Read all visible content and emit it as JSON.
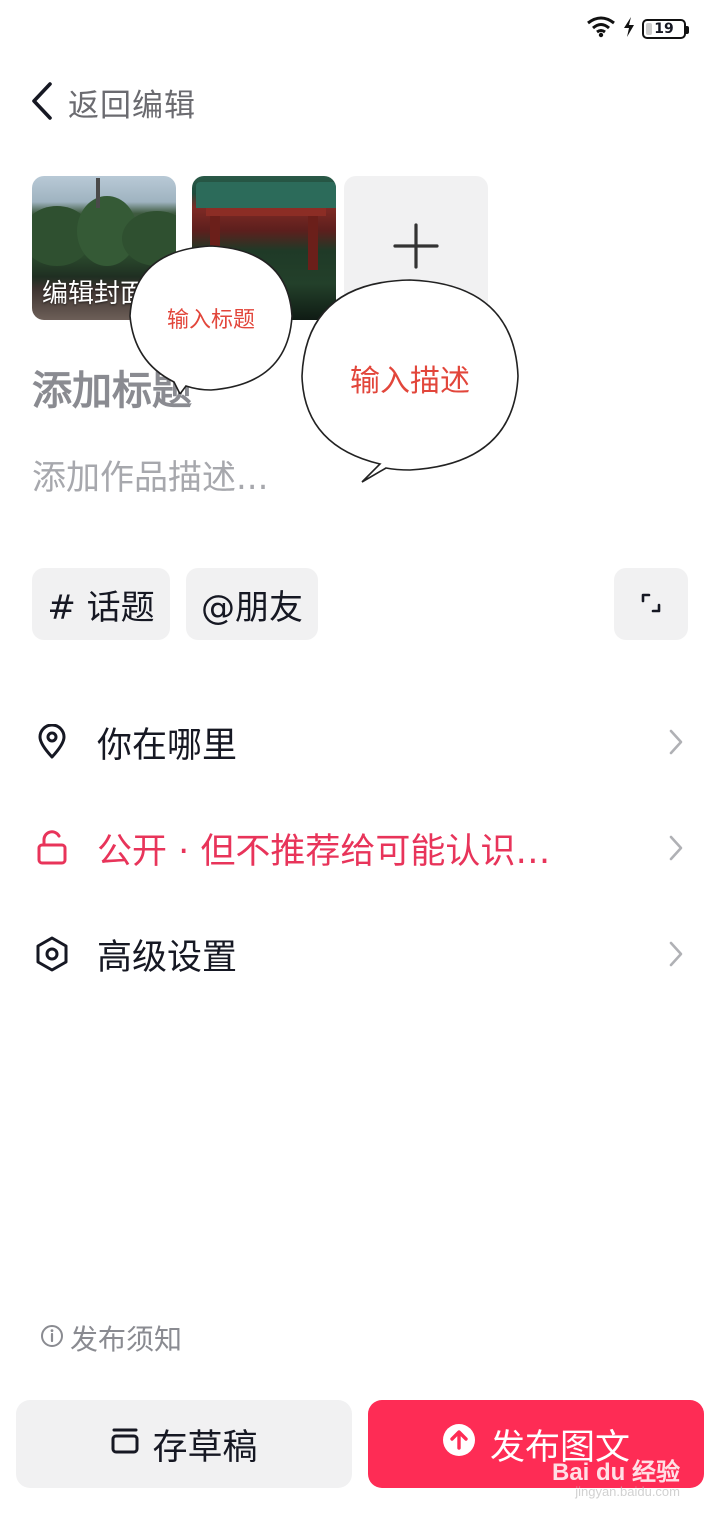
{
  "status_bar": {
    "battery_level": "19"
  },
  "header": {
    "back_label": "返回编辑"
  },
  "media": {
    "cover_label": "编辑封面"
  },
  "fields": {
    "title_placeholder": "添加标题",
    "description_placeholder": "添加作品描述..."
  },
  "annotations": {
    "title_callout": "输入标题",
    "description_callout": "输入描述"
  },
  "chips": {
    "topic": "# 话题",
    "friend": "@朋友"
  },
  "rows": [
    {
      "label": "你在哪里",
      "icon": "location-pin-icon"
    },
    {
      "label": "公开 · 但不推荐给可能认识…",
      "icon": "unlock-icon",
      "color": "#e8345a"
    },
    {
      "label": "高级设置",
      "icon": "settings-hex-icon"
    }
  ],
  "footer": {
    "notice": "发布须知",
    "draft_button": "存草稿",
    "publish_button": "发布图文"
  },
  "watermark": {
    "brand": "Bai du 经验",
    "url": "jingyan.baidu.com"
  },
  "colors": {
    "accent": "#fe2c55",
    "private_text": "#e8345a",
    "callout_text": "#e2463b"
  }
}
